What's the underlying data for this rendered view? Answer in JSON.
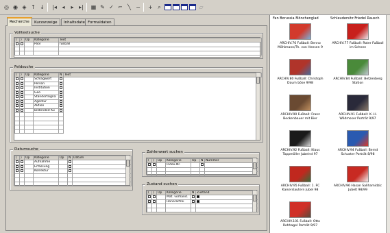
{
  "tabs": [
    {
      "label": "Recherche",
      "active": true
    },
    {
      "label": "Kurzanzeige",
      "active": false
    },
    {
      "label": "Inhaltsdaten",
      "active": false
    },
    {
      "label": "Formaldaten",
      "active": false
    }
  ],
  "volltext": {
    "title": "Volltextsuche",
    "headers": [
      "(",
      ")",
      "Op",
      "Kategorie",
      "Text"
    ],
    "rows": [
      {
        "kategorie": "Pool",
        "text": "fußball"
      }
    ]
  },
  "feld": {
    "title": "Feldsuche",
    "headers": [
      "(",
      ")",
      "Op",
      "Kategorie",
      "N",
      "Text"
    ],
    "rows": [
      {
        "kategorie": "Schlagwort"
      },
      {
        "kategorie": "Person"
      },
      {
        "kategorie": "Institution"
      },
      {
        "kategorie": "Geo"
      },
      {
        "kategorie": "Standortsigna"
      },
      {
        "kategorie": "Agentur"
      },
      {
        "kategorie": "Aktion"
      },
      {
        "kategorie": "Bildendeit Ku"
      }
    ]
  },
  "datum": {
    "title": "Datumsuche",
    "headers": [
      "(",
      ")",
      "Op",
      "Kategorie",
      "Op",
      "N",
      "Datum"
    ],
    "rows": [
      {
        "kategorie": "Aufnahme"
      },
      {
        "kategorie": "Erfassung"
      },
      {
        "kategorie": "Korrektur"
      }
    ]
  },
  "zahl": {
    "title": "Zahlenwert suchen",
    "headers": [
      "(",
      ")",
      "Op",
      "Kategorie",
      "Op",
      "N",
      "Nummer"
    ],
    "rows": [
      {
        "kategorie": "Index-Nr."
      }
    ]
  },
  "zustand": {
    "title": "Zustand suchen",
    "headers": [
      "(",
      ")",
      "Op",
      "Kategorie",
      "N",
      "Zustand"
    ],
    "rows": [
      {
        "kategorie": "Mat. vorhand."
      },
      {
        "kategorie": "Honorarfrei"
      }
    ]
  },
  "results": {
    "header_left": "Fan Borussia Mönchenglad",
    "header_right": "Schleudersitz Friedel Rausch",
    "items": [
      {
        "caption": "ARCHIV.76 Fußball: Benno Möhlmann/Th. von Heesen 9",
        "colors": [
          "#d23a2c",
          "#7ab0d8"
        ]
      },
      {
        "caption": "ARCHIV.77 Fußball: Roter Fußball im Schnee",
        "colors": [
          "#c8201c",
          "#e8e8ee"
        ]
      },
      {
        "caption": "ARCHIV.80 Fußball: Christoph Daum böse 9/98",
        "colors": [
          "#b0342a",
          "#4a6a9a"
        ]
      },
      {
        "caption": "ARCHIV.84 Fußball: Betzenberg Station",
        "colors": [
          "#4a8a3a",
          "#c0c8d0"
        ]
      },
      {
        "caption": "ARCHIV.90 Fußball: Franz Beckenbauer mit Bier",
        "colors": [
          "#6a4a32",
          "#c09060"
        ]
      },
      {
        "caption": "ARCHIV.91 Fußball: K.-H. Wildmoser Porträt 9/97",
        "colors": [
          "#2a2a3a",
          "#8a7a6a"
        ]
      },
      {
        "caption": "ARCHIV.92 Fußball: Klaus Toppmöller Jubelnd 97",
        "colors": [
          "#1a1a1a",
          "#d8d8d8"
        ]
      },
      {
        "caption": "ARCHIV.94 Fußball: Bernd Schuster Porträt 8/98",
        "colors": [
          "#2a5ab0",
          "#d83a2a"
        ]
      },
      {
        "caption": "ARCHIV.95 Fußball: 1. FC Kaiserslautern Jubel 98",
        "colors": [
          "#c0281e",
          "#3a6a3a"
        ]
      },
      {
        "caption": "ARCHIV.96 Hasan Salihamidzic Jubelt 98/99",
        "colors": [
          "#c82a22",
          "#f0f0f0"
        ]
      },
      {
        "caption": "ARCHIV.101 Fußball: Otto Rehhagel Porträt 9/97",
        "colors": [
          "#d03028",
          "#5a4a3a"
        ]
      }
    ]
  }
}
